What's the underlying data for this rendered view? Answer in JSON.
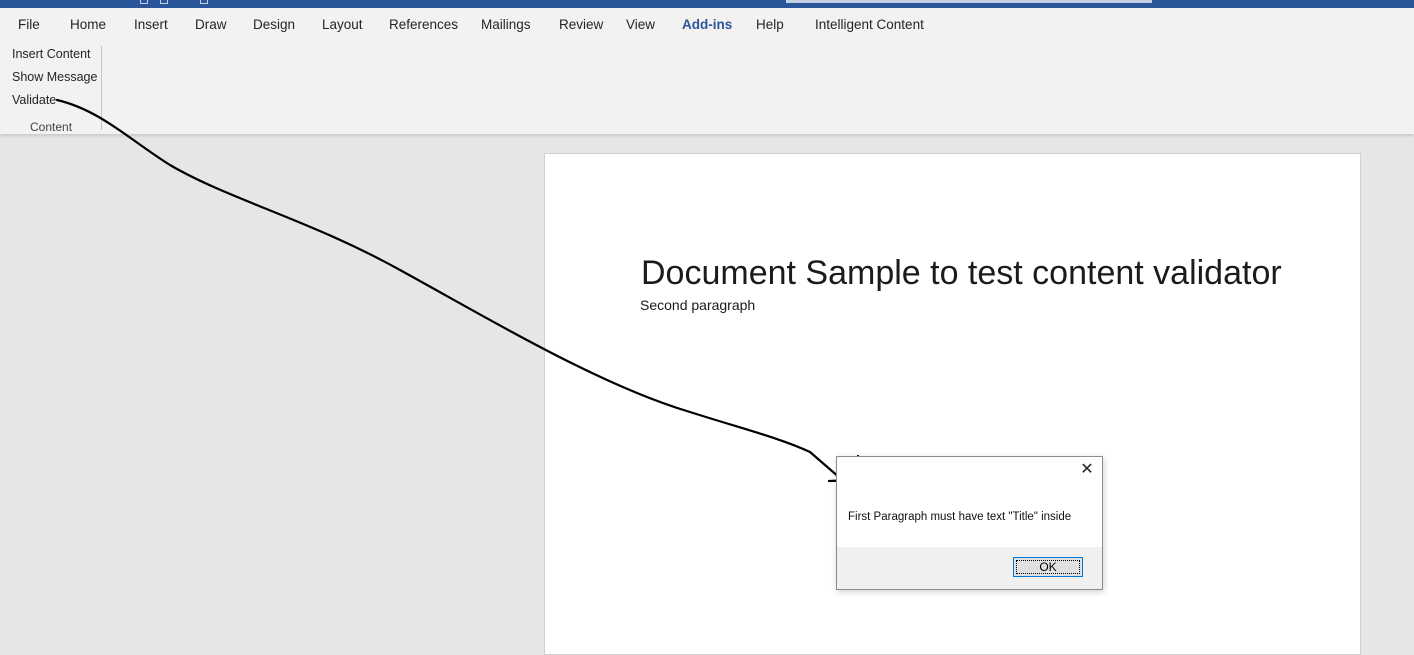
{
  "menubar": {
    "tabs": [
      {
        "label": "File"
      },
      {
        "label": "Home"
      },
      {
        "label": "Insert"
      },
      {
        "label": "Draw"
      },
      {
        "label": "Design"
      },
      {
        "label": "Layout"
      },
      {
        "label": "References"
      },
      {
        "label": "Mailings"
      },
      {
        "label": "Review"
      },
      {
        "label": "View"
      },
      {
        "label": "Add-ins"
      },
      {
        "label": "Help"
      },
      {
        "label": "Intelligent Content"
      }
    ],
    "active_tab": "Add-ins"
  },
  "ribbon": {
    "buttons": [
      {
        "label": "Insert Content"
      },
      {
        "label": "Show Message"
      },
      {
        "label": "Validate"
      }
    ],
    "group_label": "Content"
  },
  "document": {
    "title": "Document Sample to test content validator",
    "paragraph": "Second paragraph"
  },
  "dialog": {
    "message": "First Paragraph must have text \"Title\" inside",
    "ok_label": "OK",
    "close_glyph": "✕"
  },
  "colors": {
    "brand": "#2b579a",
    "ribbon_bg": "#f3f2f1",
    "canvas_bg": "#e6e6e6"
  }
}
